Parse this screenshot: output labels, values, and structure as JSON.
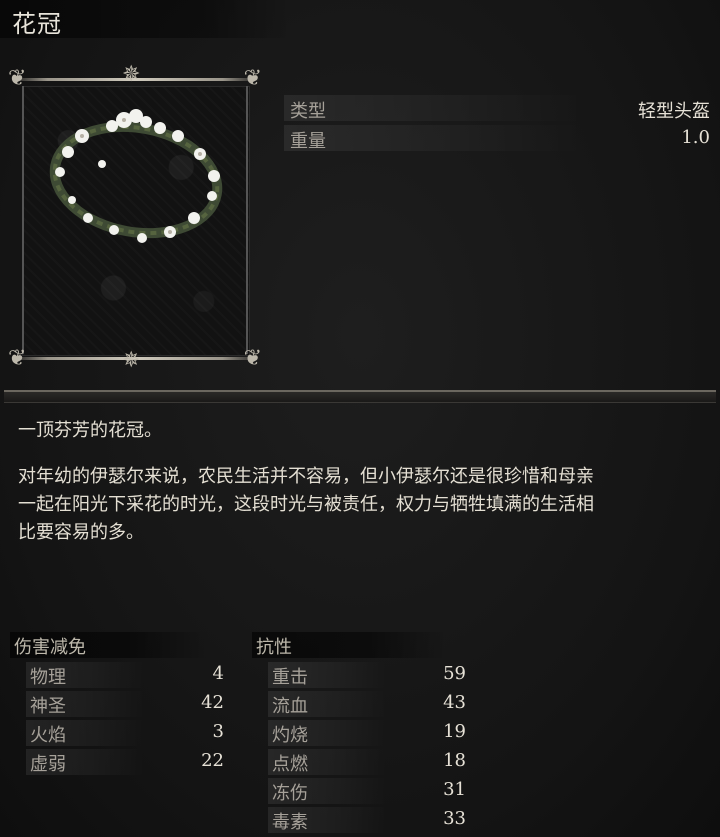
{
  "item": {
    "name": "花冠"
  },
  "info": [
    {
      "label": "类型",
      "value": "轻型头盔"
    },
    {
      "label": "重量",
      "value": "1.0"
    }
  ],
  "description": {
    "line1": "一顶芬芳的花冠。",
    "para2_l1": "对年幼的伊瑟尔来说，农民生活并不容易，但小伊瑟尔还是很珍惜和母亲",
    "para2_l2": "一起在阳光下采花的时光，这段时光与被责任，权力与牺牲填满的生活相",
    "para2_l3": "比要容易的多。"
  },
  "damage_reduction": {
    "header": "伤害减免",
    "rows": [
      {
        "name": "物理",
        "value": "4"
      },
      {
        "name": "神圣",
        "value": "42"
      },
      {
        "name": "火焰",
        "value": "3"
      },
      {
        "name": "虚弱",
        "value": "22"
      }
    ]
  },
  "resistance": {
    "header": "抗性",
    "rows": [
      {
        "name": "重击",
        "value": "59"
      },
      {
        "name": "流血",
        "value": "43"
      },
      {
        "name": "灼烧",
        "value": "19"
      },
      {
        "name": "点燃",
        "value": "18"
      },
      {
        "name": "冻伤",
        "value": "31"
      },
      {
        "name": "毒素",
        "value": "33"
      }
    ]
  },
  "icons": {
    "ornament": "ornament-icon",
    "wreath": "flower-wreath-icon"
  },
  "colors": {
    "background": "#161616",
    "text": "#e6e1d6",
    "label": "#a6a199"
  }
}
